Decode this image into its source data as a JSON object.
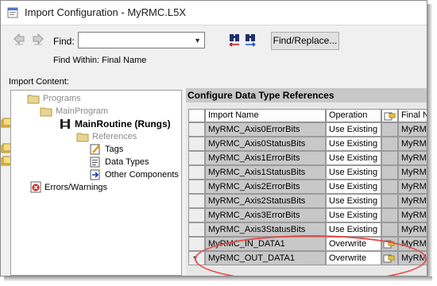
{
  "window": {
    "title": "Import Configuration - MyRMC.L5X"
  },
  "toolbar": {
    "find_label": "Find:",
    "find_value": "",
    "find_within": "Find Within: Final Name",
    "find_replace_label": "Find/Replace..."
  },
  "import_content_label": "Import Content:",
  "tree": {
    "programs": "Programs",
    "main_program": "MainProgram",
    "main_routine": "MainRoutine (Rungs)",
    "references": "References",
    "tags": "Tags",
    "data_types": "Data Types",
    "other_components": "Other Components",
    "errors_warnings": "Errors/Warnings"
  },
  "panel": {
    "title": "Configure Data Type References",
    "columns": {
      "import_name": "Import Name",
      "operation": "Operation",
      "final_name": "Final N"
    },
    "rows": [
      {
        "import_name": "MyRMC_Axis0ErrorBits",
        "operation": "Use Existing",
        "final_name": "MyRMC",
        "marker": ""
      },
      {
        "import_name": "MyRMC_Axis0StatusBits",
        "operation": "Use Existing",
        "final_name": "MyRMC",
        "marker": ""
      },
      {
        "import_name": "MyRMC_Axis1ErrorBits",
        "operation": "Use Existing",
        "final_name": "MyRMC",
        "marker": ""
      },
      {
        "import_name": "MyRMC_Axis1StatusBits",
        "operation": "Use Existing",
        "final_name": "MyRMC",
        "marker": ""
      },
      {
        "import_name": "MyRMC_Axis2ErrorBits",
        "operation": "Use Existing",
        "final_name": "MyRMC",
        "marker": ""
      },
      {
        "import_name": "MyRMC_Axis2StatusBits",
        "operation": "Use Existing",
        "final_name": "MyRMC",
        "marker": ""
      },
      {
        "import_name": "MyRMC_Axis3ErrorBits",
        "operation": "Use Existing",
        "final_name": "MyRMC",
        "marker": ""
      },
      {
        "import_name": "MyRMC_Axis3StatusBits",
        "operation": "Use Existing",
        "final_name": "MyRMC",
        "marker": ""
      },
      {
        "import_name": "MyRMC_IN_DATA1",
        "operation": "Overwrite",
        "final_name": "MyRMC",
        "marker": ""
      },
      {
        "import_name": "MyRMC_OUT_DATA1",
        "operation": "Overwrite",
        "final_name": "MyRMC",
        "marker": "*"
      }
    ]
  },
  "colors": {
    "highlight_ellipse": "#e84a4a",
    "panel_header": "#c8c8c8"
  },
  "icons": [
    "app-icon",
    "back-arrow-icon",
    "forward-arrow-icon",
    "binoculars-icon",
    "folder-icon",
    "routine-icon",
    "tags-icon",
    "data-types-icon",
    "other-components-icon",
    "error-icon",
    "find-replace-column-icon"
  ]
}
